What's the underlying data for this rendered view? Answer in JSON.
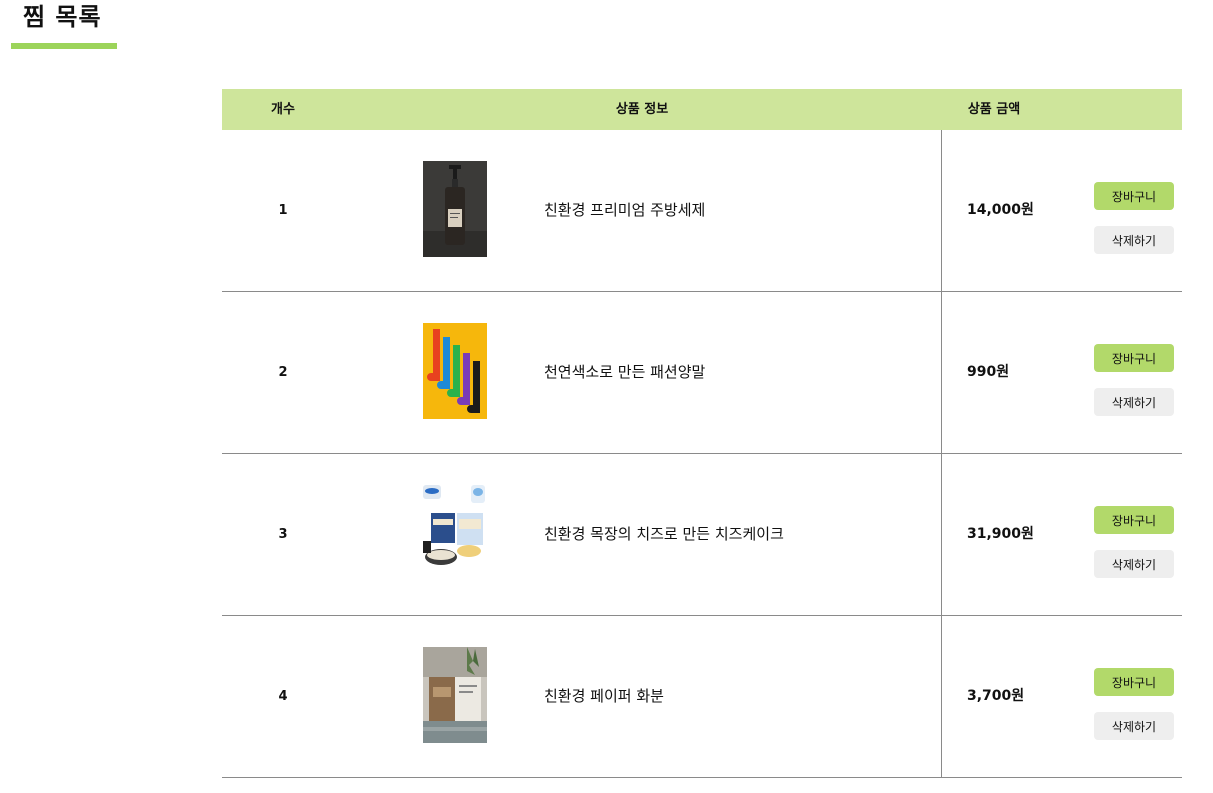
{
  "header": {
    "title": "찜 목록"
  },
  "table": {
    "columns": {
      "count": "개수",
      "info": "상품 정보",
      "price": "상품 금액"
    },
    "rows": [
      {
        "no": "1",
        "name": "친환경 프리미엄 주방세제",
        "price": "14,000원",
        "cart_label": "장바구니",
        "delete_label": "삭제하기",
        "image": "soap-bottle-image"
      },
      {
        "no": "2",
        "name": "천연색소로 만든 패션양말",
        "price": "990원",
        "cart_label": "장바구니",
        "delete_label": "삭제하기",
        "image": "colorful-socks-image"
      },
      {
        "no": "3",
        "name": "친환경 목장의 치즈로 만든 치즈케이크",
        "price": "31,900원",
        "cart_label": "장바구니",
        "delete_label": "삭제하기",
        "image": "cheesecake-package-image"
      },
      {
        "no": "4",
        "name": "친환경 페이퍼 화분",
        "price": "3,700원",
        "cart_label": "장바구니",
        "delete_label": "삭제하기",
        "image": "paper-pot-image"
      }
    ]
  },
  "colors": {
    "accent": "#9cd45a",
    "header_bg": "#cee59b",
    "cart_button": "#b2d96a",
    "delete_button": "#eeeeee"
  }
}
